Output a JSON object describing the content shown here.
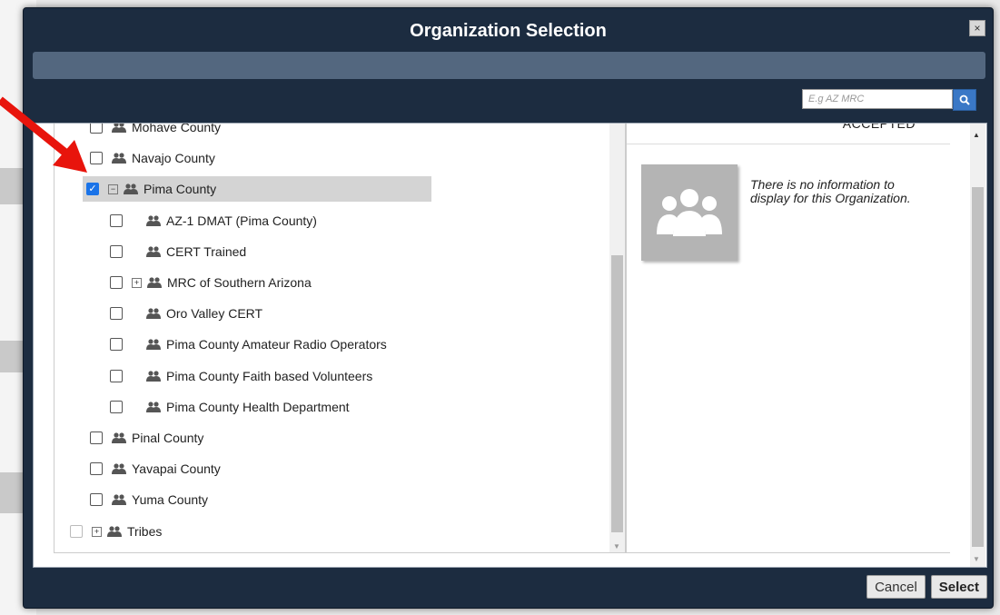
{
  "dialog": {
    "title": "Organization Selection",
    "close_label": "×",
    "search": {
      "placeholder": "E.g AZ MRC",
      "value": ""
    }
  },
  "tree": [
    {
      "label": "Mohave County",
      "checked": false
    },
    {
      "label": "Navajo County",
      "checked": false
    },
    {
      "label": "Pima County",
      "checked": true,
      "expanded": true,
      "expander": "⊟"
    },
    {
      "label": "AZ-1 DMAT (Pima County)",
      "checked": false
    },
    {
      "label": "CERT Trained",
      "checked": false
    },
    {
      "label": "MRC of Southern Arizona",
      "checked": false,
      "expander": "⊞"
    },
    {
      "label": "Oro Valley CERT",
      "checked": false
    },
    {
      "label": "Pima County Amateur Radio Operators",
      "checked": false
    },
    {
      "label": "Pima County Faith based Volunteers",
      "checked": false
    },
    {
      "label": "Pima County Health Department",
      "checked": false
    },
    {
      "label": "Pinal County",
      "checked": false
    },
    {
      "label": "Yavapai County",
      "checked": false
    },
    {
      "label": "Yuma County",
      "checked": false
    },
    {
      "label": "Tribes",
      "checked": false,
      "expander": "⊞",
      "disabled": true
    }
  ],
  "details": {
    "status_label": "ACCEPTED",
    "no_info_text": "There is no information to display for this Organization."
  },
  "footer": {
    "cancel_label": "Cancel",
    "select_label": "Select"
  },
  "colors": {
    "modal_bg": "#1c2c40",
    "subbar": "#53677f",
    "selected_row": "#d4d4d4",
    "annotation": "#e8140c",
    "checkbox_checked": "#1a73e8"
  }
}
